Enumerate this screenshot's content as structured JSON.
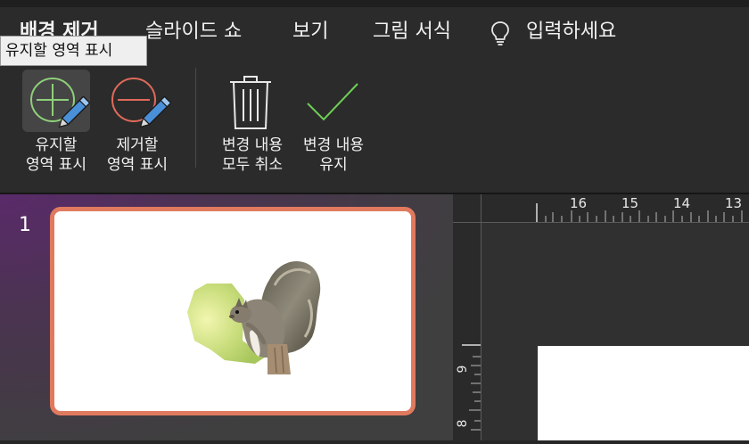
{
  "tabs": [
    {
      "label": "배경 제거",
      "active": true
    },
    {
      "label": "슬라이드 쇼",
      "active": false
    },
    {
      "label": "보기",
      "active": false
    },
    {
      "label": "그림 서식",
      "active": false
    }
  ],
  "tell_me": {
    "label": "입력하세요",
    "icon": "lightbulb-icon"
  },
  "tooltip": "유지할 영역 표시",
  "ribbon": {
    "keep": {
      "line1": "유지할",
      "line2": "영역 표시",
      "icon": "pencil-plus-icon",
      "selected": true
    },
    "remove": {
      "line1": "제거할",
      "line2": "영역 표시",
      "icon": "pencil-minus-icon"
    },
    "discard": {
      "line1": "변경 내용",
      "line2": "모두 취소",
      "icon": "trash-icon"
    },
    "keep_changes": {
      "line1": "변경 내용",
      "line2": "유지",
      "icon": "checkmark-icon"
    }
  },
  "thumbnails": [
    {
      "number": "1"
    }
  ],
  "ruler": {
    "h_labels": [
      "16",
      "15",
      "14",
      "13"
    ],
    "v_labels": [
      "9",
      "8"
    ]
  },
  "colors": {
    "accent": "#e07a5f",
    "keep_icon": "#8fd07a",
    "remove_icon": "#e06a5a",
    "pencil": "#4a90d9",
    "check": "#6fcf57"
  }
}
